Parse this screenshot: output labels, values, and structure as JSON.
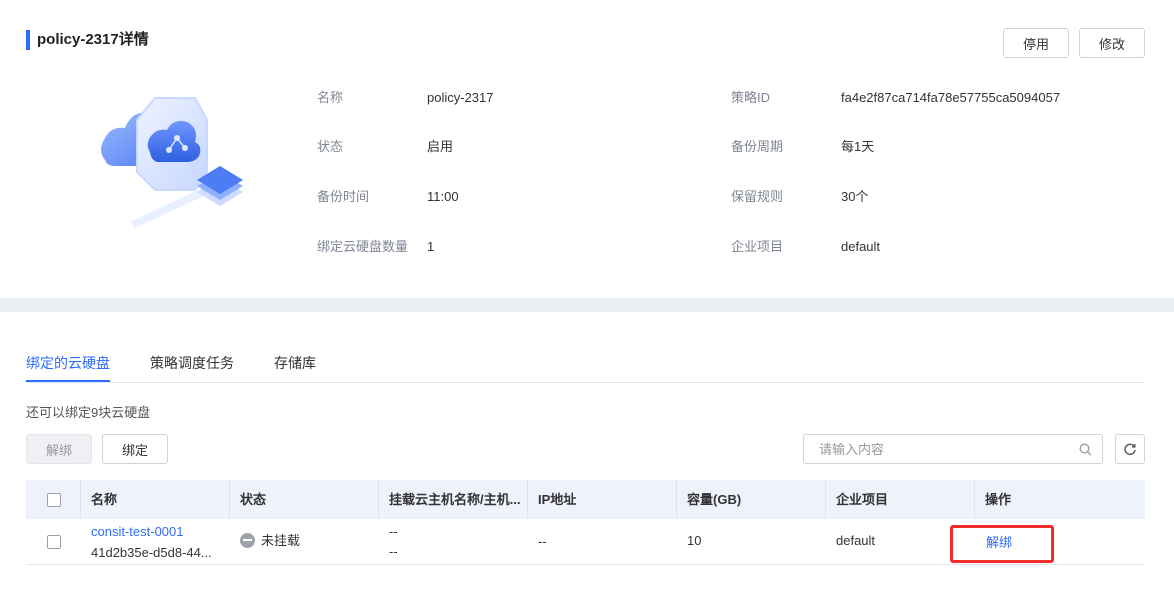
{
  "header": {
    "title": "policy-2317详情",
    "disable_label": "停用",
    "edit_label": "修改"
  },
  "info": {
    "name_label": "名称",
    "name_value": "policy-2317",
    "policy_id_label": "策略ID",
    "policy_id_value": "fa4e2f87ca714fa78e57755ca5094057",
    "status_label": "状态",
    "status_value": "启用",
    "backup_cycle_label": "备份周期",
    "backup_cycle_value": "每1天",
    "backup_time_label": "备份时间",
    "backup_time_value": "11:00",
    "retention_label": "保留规则",
    "retention_value": "30个",
    "bound_disks_label": "绑定云硬盘数量",
    "bound_disks_value": "1",
    "project_label": "企业项目",
    "project_value": "default"
  },
  "tabs": [
    {
      "label": "绑定的云硬盘",
      "active": true
    },
    {
      "label": "策略调度任务",
      "active": false
    },
    {
      "label": "存储库",
      "active": false
    }
  ],
  "toolbar": {
    "hint": "还可以绑定9块云硬盘",
    "unbind_label": "解绑",
    "bind_label": "绑定",
    "search_placeholder": "请输入内容"
  },
  "table": {
    "columns": [
      "名称",
      "状态",
      "挂载云主机名称/主机...",
      "IP地址",
      "容量(GB)",
      "企业项目",
      "操作"
    ],
    "rows": [
      {
        "name": "consit-test-0001",
        "id": "41d2b35e-d5d8-44...",
        "status": "未挂载",
        "host_line1": "--",
        "host_line2": "--",
        "ip": "--",
        "capacity": "10",
        "project": "default",
        "action": "解绑"
      }
    ]
  },
  "colors": {
    "accent": "#2f6bff",
    "highlight": "#f22c2c"
  }
}
